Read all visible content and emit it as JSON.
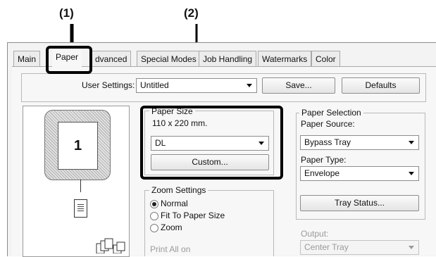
{
  "callouts": {
    "c1": "(1)",
    "c2": "(2)"
  },
  "tabs": [
    "Main",
    "Paper",
    "dvanced",
    "Special Modes",
    "Job Handling",
    "Watermarks",
    "Color"
  ],
  "user_settings": {
    "label": "User Settings:",
    "value": "Untitled",
    "save": "Save...",
    "defaults": "Defaults"
  },
  "preview": {
    "page_number": "1"
  },
  "paper_size": {
    "title": "Paper Size",
    "dimensions": "110 x 220 mm.",
    "value": "DL",
    "custom": "Custom..."
  },
  "zoom": {
    "title": "Zoom Settings",
    "options": [
      "Normal",
      "Fit To Paper Size",
      "Zoom"
    ],
    "selected": "Normal"
  },
  "print_all_on": "Print All on",
  "paper_selection": {
    "title": "Paper Selection",
    "source_label": "Paper Source:",
    "source_value": "Bypass Tray",
    "type_label": "Paper Type:",
    "type_value": "Envelope",
    "tray_status": "Tray Status..."
  },
  "output": {
    "label": "Output:",
    "value": "Center Tray"
  }
}
